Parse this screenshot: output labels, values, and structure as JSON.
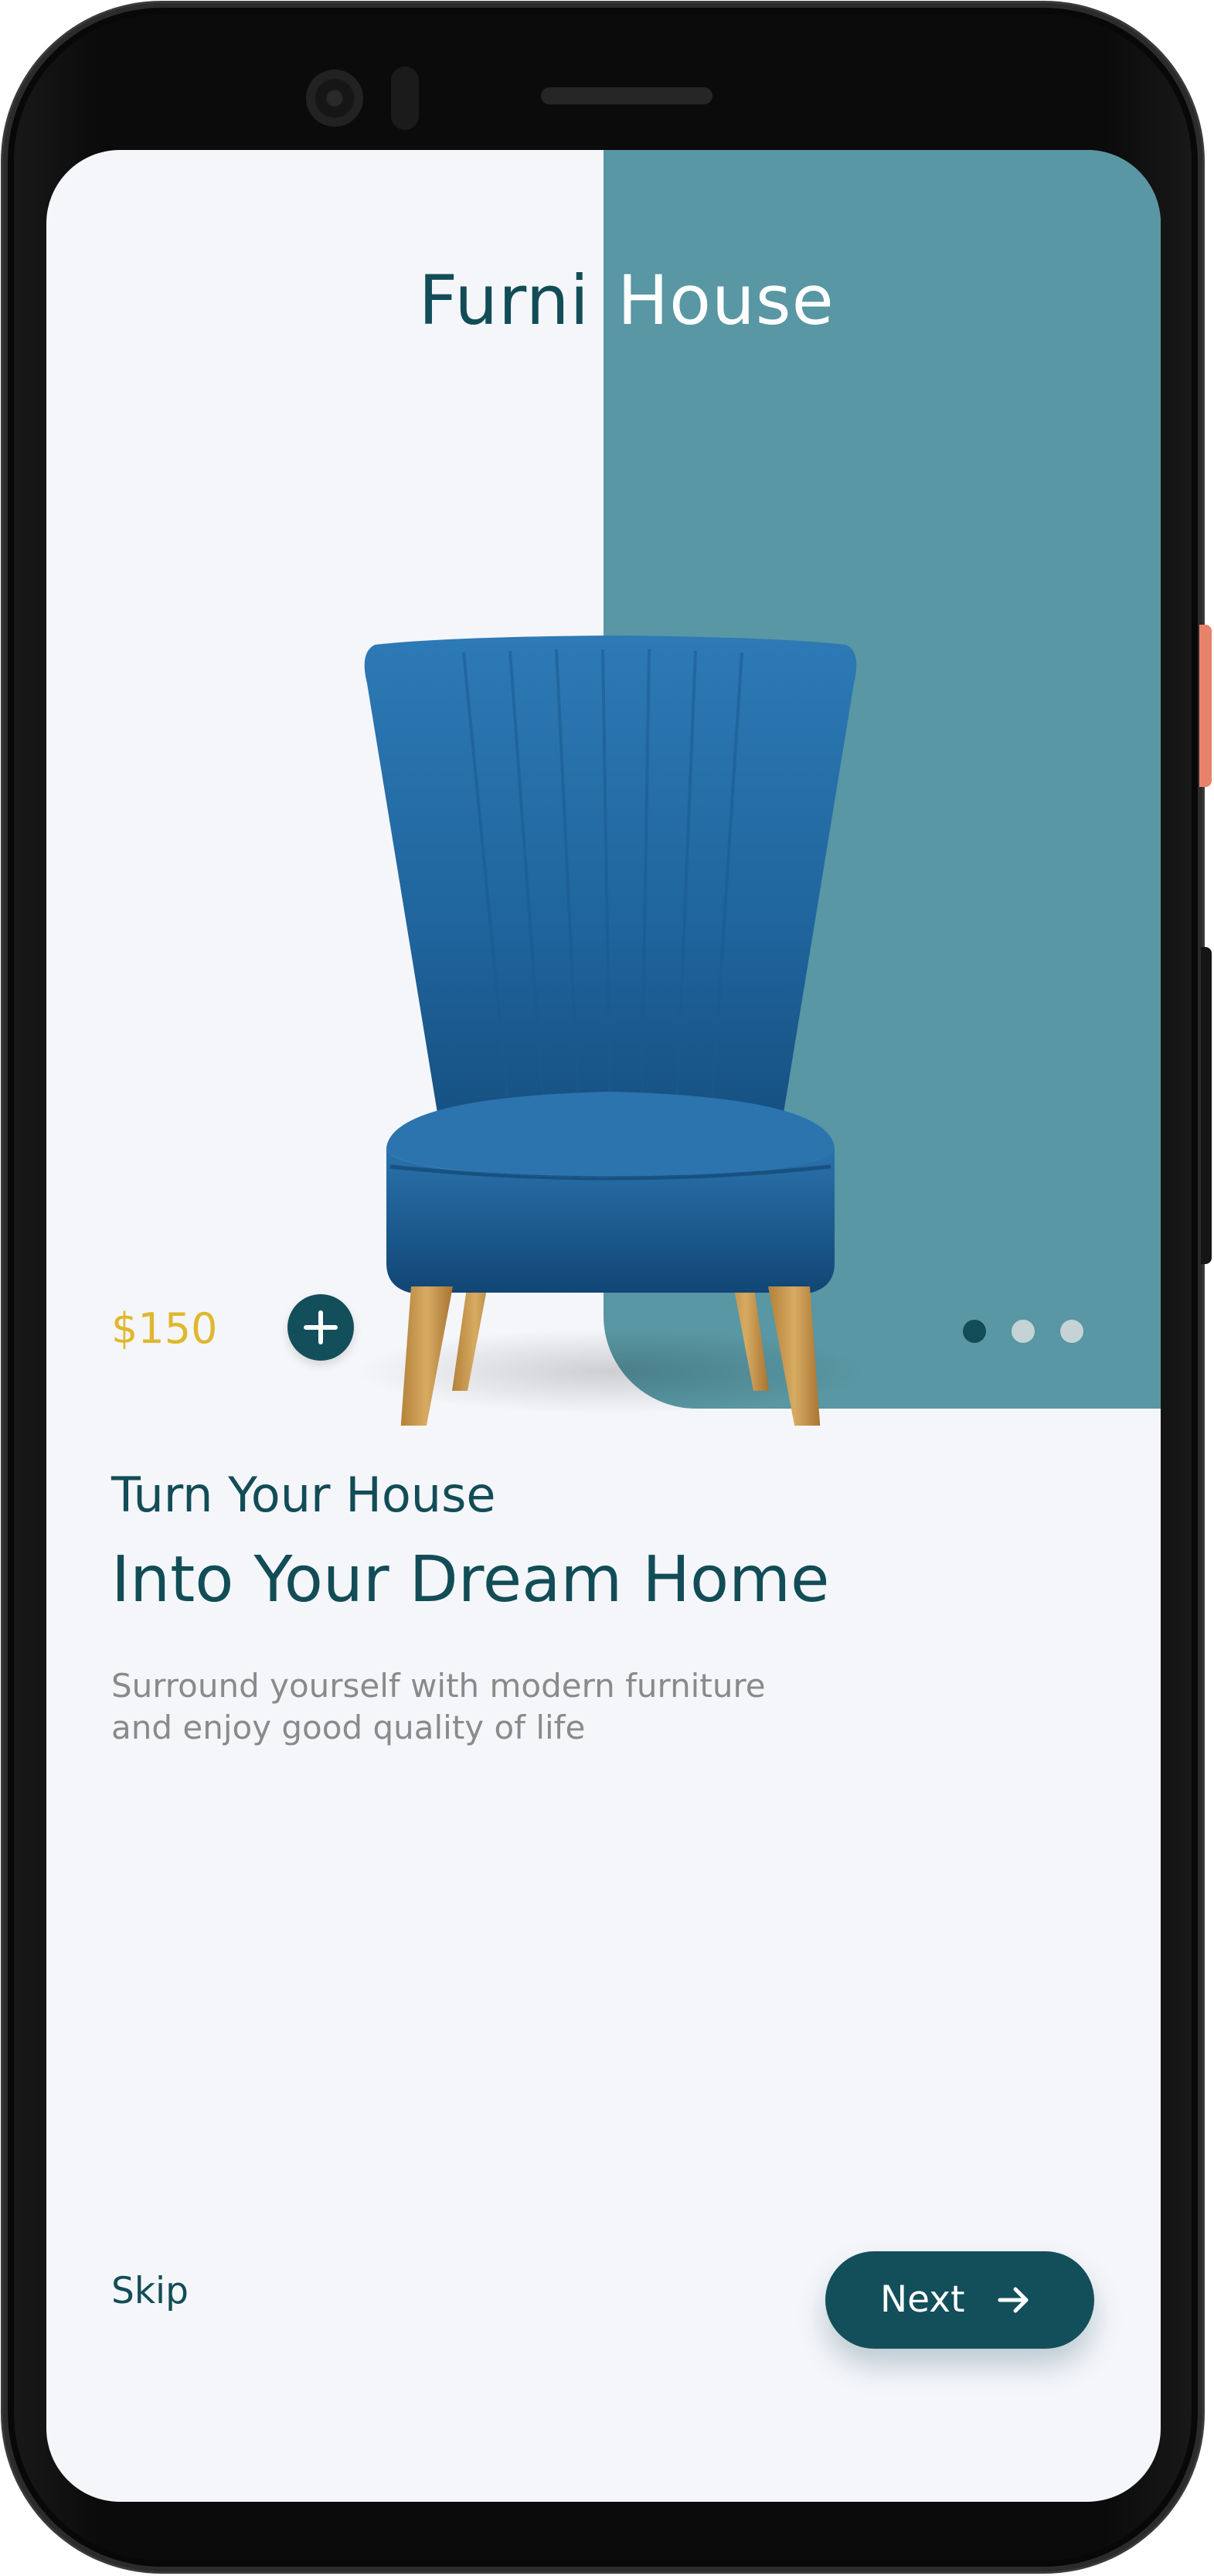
{
  "app": {
    "brand_part1": "Furni",
    "brand_part2": "House"
  },
  "product": {
    "price": "$150",
    "image": "blue-velvet-armchair",
    "add_icon": "plus-icon"
  },
  "carousel": {
    "total": 3,
    "active_index": 0
  },
  "onboarding": {
    "subtitle": "Turn Your House",
    "headline": "Into Your Dream Home",
    "description": "Surround yourself with modern furniture and enjoy good quality of life"
  },
  "actions": {
    "skip_label": "Skip",
    "next_label": "Next",
    "next_icon": "arrow-right-icon"
  },
  "colors": {
    "primary": "#124d57",
    "panel": "#5897a3",
    "accent": "#e0b72d",
    "background": "#f5f6fa",
    "muted_text": "#8a8a8a"
  }
}
